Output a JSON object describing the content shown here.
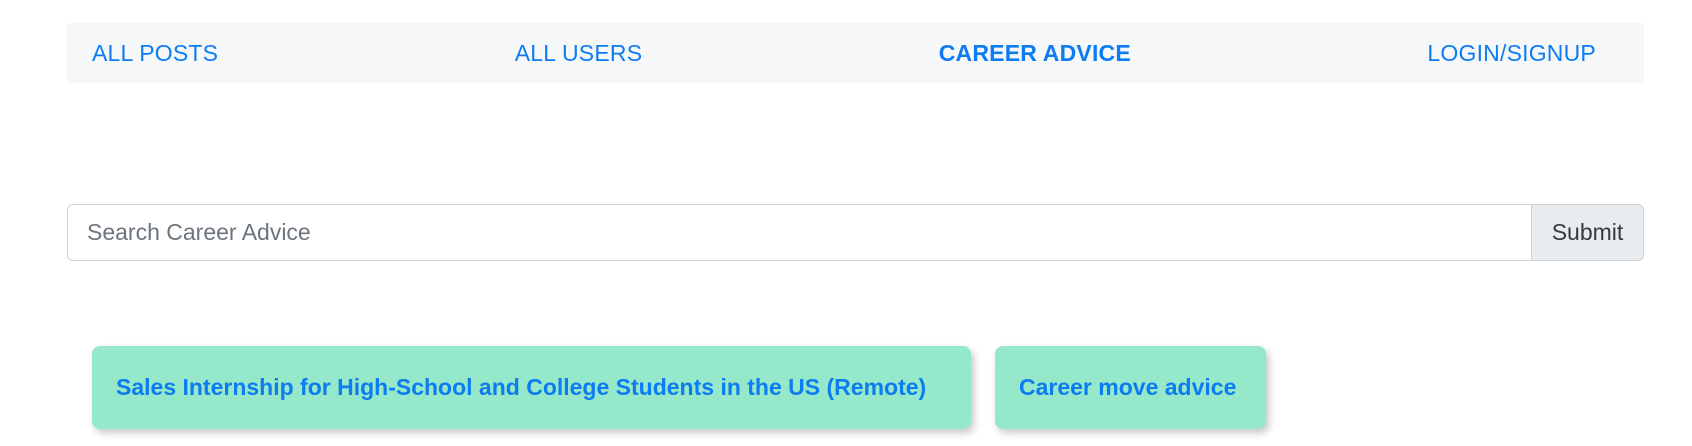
{
  "nav": {
    "items": [
      {
        "label": "ALL POSTS"
      },
      {
        "label": "ALL USERS"
      },
      {
        "label": "CAREER ADVICE"
      },
      {
        "label": "LOGIN/SIGNUP"
      }
    ],
    "active": "CAREER ADVICE",
    "link_color": "#0d7cf2",
    "background": "#f6f7f8"
  },
  "search": {
    "placeholder": "Search Career Advice",
    "value": "",
    "submit_label": "Submit"
  },
  "advice_cards": [
    {
      "title": "Sales Internship for High-School and College Students in the US (Remote)"
    },
    {
      "title": "Career move advice"
    }
  ],
  "card_color": "#95e8ca"
}
